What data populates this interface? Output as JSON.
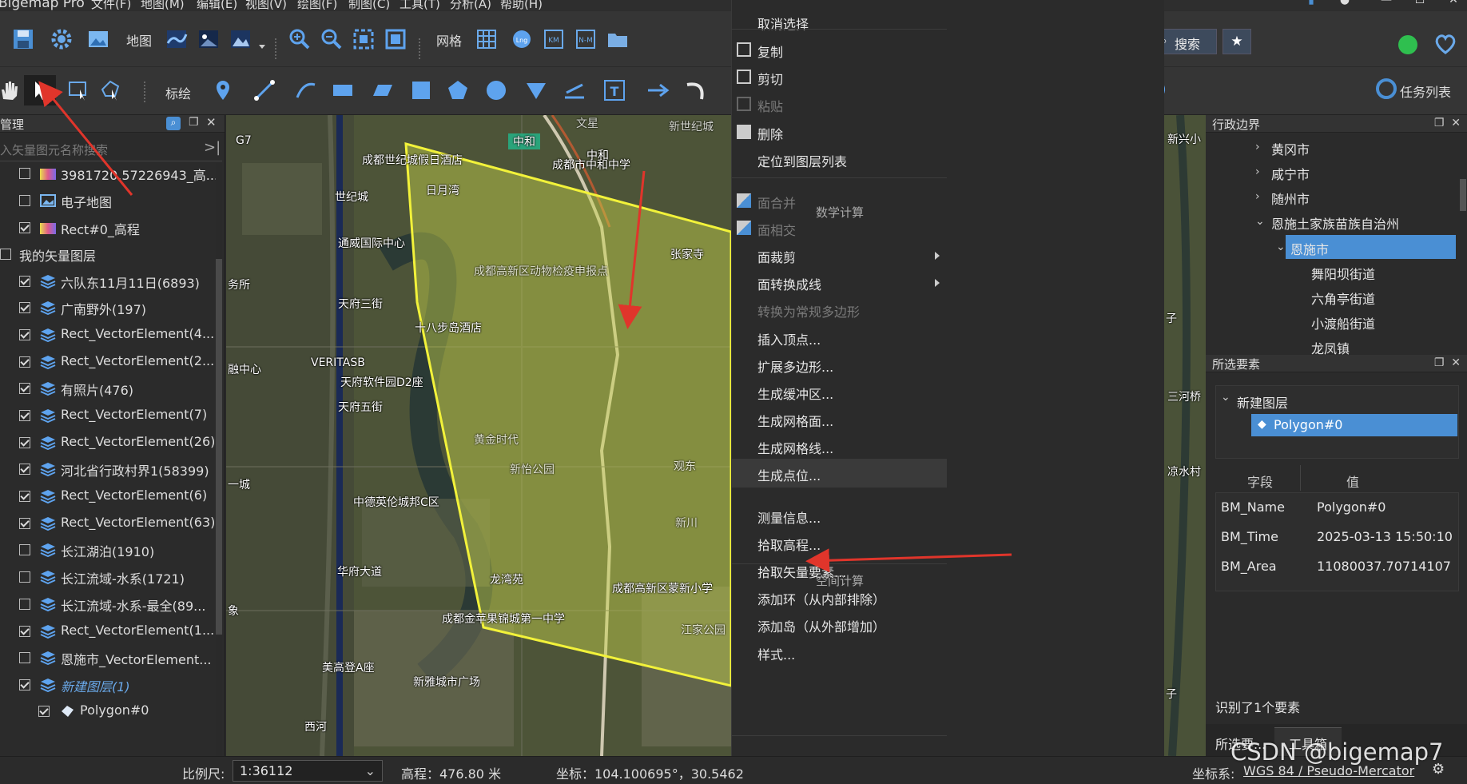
{
  "menubar": {
    "app_title": "Bigemap Pro",
    "items": [
      "文件(F)",
      "地图(M)",
      "编辑(E)",
      "视图(V)",
      "绘图(F)",
      "制图(C)",
      "工具(T)",
      "分析(A)",
      "帮助(H)"
    ]
  },
  "toolbar1": {
    "map_label": "地图",
    "grid_label": "网格",
    "search_label": "搜索"
  },
  "toolbar2": {
    "annotate_label": "标绘",
    "tasks_label": "任务列表"
  },
  "left_panel": {
    "title": "管理",
    "search_placeholder": "入矢量图元名称搜索",
    "layers": [
      {
        "label": "3981720.57226943_高...",
        "checked": false,
        "icon": "gradient-icon"
      },
      {
        "label": "电子地图",
        "checked": false,
        "icon": "map-image-icon"
      },
      {
        "label": "Rect#0_高程",
        "checked": true,
        "icon": "gradient-icon"
      },
      {
        "label": "我的矢量图层",
        "checked": false,
        "icon": "none"
      },
      {
        "label": "六队东11月11日(6893)",
        "checked": true,
        "icon": "layers-icon"
      },
      {
        "label": "广南野外(197)",
        "checked": true,
        "icon": "layers-icon"
      },
      {
        "label": "Rect_VectorElement(4...",
        "checked": true,
        "icon": "layers-icon"
      },
      {
        "label": "Rect_VectorElement(2...",
        "checked": true,
        "icon": "layers-icon"
      },
      {
        "label": "有照片(476)",
        "checked": true,
        "icon": "layers-icon"
      },
      {
        "label": "Rect_VectorElement(7)",
        "checked": true,
        "icon": "layers-icon"
      },
      {
        "label": "Rect_VectorElement(26)",
        "checked": true,
        "icon": "layers-icon"
      },
      {
        "label": "河北省行政村界1(58399)",
        "checked": true,
        "icon": "layers-icon"
      },
      {
        "label": "Rect_VectorElement(6)",
        "checked": true,
        "icon": "layers-icon"
      },
      {
        "label": "Rect_VectorElement(63)",
        "checked": true,
        "icon": "layers-icon"
      },
      {
        "label": "长江湖泊(1910)",
        "checked": false,
        "icon": "layers-icon"
      },
      {
        "label": "长江流域-水系(1721)",
        "checked": false,
        "icon": "layers-icon"
      },
      {
        "label": "长江流域-水系-最全(89...",
        "checked": false,
        "icon": "layers-icon"
      },
      {
        "label": "Rect_VectorElement(1...",
        "checked": true,
        "icon": "layers-icon"
      },
      {
        "label": "恩施市_VectorElement...",
        "checked": false,
        "icon": "layers-icon"
      },
      {
        "label": "新建图层(1)",
        "checked": true,
        "icon": "layers-icon"
      },
      {
        "label": "Polygon#0",
        "checked": true,
        "icon": "polygon-icon"
      }
    ]
  },
  "map": {
    "pois": [
      "成都世纪城假日酒店",
      "成都市中和中学",
      "中和",
      "中和",
      "世纪城",
      "通威国际中心",
      "天府三街",
      "十八步岛酒店",
      "VERITASB",
      "天府软件园D2座",
      "天府五街",
      "中德英伦城邦C区",
      "华府大道",
      "龙湾苑",
      "成都高新区蒙新小学",
      "成都金苹果锦城第一中学",
      "美高登A座",
      "新雅城市广场",
      "西河",
      "成都高新区动物检疫申报点",
      "张家寺",
      "新世纪城",
      "黄金时代",
      "新怡公园",
      "文星",
      "观东",
      "新川",
      "江家公园",
      "日月湾",
      "G7",
      "融中心",
      "务所",
      "一城",
      "象"
    ]
  },
  "context_menu": {
    "items": [
      "取消选择",
      "复制",
      "剪切",
      "粘贴",
      "删除",
      "定位到图层列表",
      "面合并",
      "面相交",
      "面裁剪",
      "面转换成线",
      "转换为常规多边形",
      "插入顶点...",
      "扩展多边形...",
      "生成缓冲区...",
      "生成网格面...",
      "生成网格线...",
      "生成点位...",
      "测量信息...",
      "拾取高程...",
      "拾取矢量要素...",
      "添加环（从内部排除）",
      "添加岛（从外部增加）",
      "样式..."
    ],
    "section_math": "数学计算",
    "section_space": "空间计算"
  },
  "right_strip": {
    "labels": [
      "新兴小",
      "子",
      "三河桥",
      "凉水村",
      "子"
    ]
  },
  "admin_panel": {
    "title": "行政边界",
    "items": [
      "黄冈市",
      "咸宁市",
      "随州市",
      "恩施土家族苗族自治州",
      "恩施市",
      "舞阳坝街道",
      "六角亭街道",
      "小渡船街道",
      "龙凤镇"
    ]
  },
  "selected_panel": {
    "title": "所选要素",
    "layer": "新建图层",
    "feature": "Polygon#0",
    "col_field": "字段",
    "col_value": "值",
    "rows": [
      {
        "k": "BM_Name",
        "v": "Polygon#0"
      },
      {
        "k": "BM_Time",
        "v": "2025-03-13 15:50:10"
      },
      {
        "k": "BM_Area",
        "v": "11080037.70714107"
      }
    ],
    "summary": "识别了1个要素",
    "tabs": [
      "所选要...",
      "工具箱"
    ]
  },
  "status": {
    "scale_label": "比例尺:",
    "scale_value": "1:36112",
    "elev": "高程：476.80 米",
    "coords": "坐标：104.100695°，30.5462",
    "crs_label": "坐标系:",
    "crs_value": "WGS 84 / Pseudo-Mercator"
  },
  "watermark": "CSDN @bigemap7",
  "colors": {
    "accent": "#4a8fd4",
    "polygon_stroke": "#f2f23a",
    "arrow": "#e0352b"
  }
}
